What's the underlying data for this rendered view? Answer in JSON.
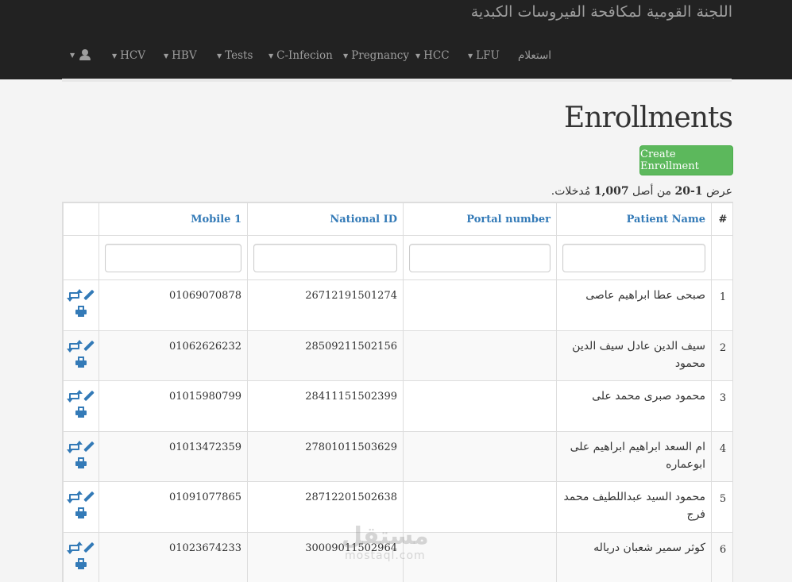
{
  "navbar": {
    "brand": "اللجنة القومية لمكافحة الفيروسات الكبدية",
    "items": [
      {
        "label": "استعلام",
        "caret": false
      },
      {
        "label": "LFU",
        "caret": true
      },
      {
        "label": "HCC",
        "caret": true
      },
      {
        "label": "Pregnancy",
        "caret": true
      },
      {
        "label": "C-Infecion",
        "caret": true
      },
      {
        "label": "Tests",
        "caret": true
      },
      {
        "label": "HBV",
        "caret": true
      },
      {
        "label": "HCV",
        "caret": true
      }
    ],
    "user_icon": "user-icon",
    "background": "#222222",
    "text_color": "#9d9d9d"
  },
  "page": {
    "title": "Enrollments",
    "create_button": "Create Enrollment",
    "create_button_color": "#5cb85c",
    "summary": {
      "prefix": "عرض",
      "range": "1-20",
      "middle": "من أصل",
      "total": "1,007",
      "suffix": "مُدخلات."
    }
  },
  "table": {
    "columns": {
      "num": "#",
      "patient_name": "Patient Name",
      "portal_number": "Portal number",
      "national_id": "National ID",
      "mobile": "Mobile 1"
    },
    "link_color": "#337ab7",
    "rows": [
      {
        "num": "1",
        "name": "صبحى عطا ابراهيم عاصى",
        "portal": "",
        "national_id": "26712191501274",
        "mobile": "01069070878"
      },
      {
        "num": "2",
        "name": "سيف الدين عادل سيف الدين محمود",
        "portal": "",
        "national_id": "28509211502156",
        "mobile": "01062626232"
      },
      {
        "num": "3",
        "name": "محمود صبرى محمد على",
        "portal": "",
        "national_id": "28411151502399",
        "mobile": "01015980799"
      },
      {
        "num": "4",
        "name": "ام السعد ابراهيم ابراهيم على ابوعماره",
        "portal": "",
        "national_id": "27801011503629",
        "mobile": "01013472359"
      },
      {
        "num": "5",
        "name": "محمود السيد عبداللطيف محمد فرج",
        "portal": "",
        "national_id": "28712201502638",
        "mobile": "01091077865"
      },
      {
        "num": "6",
        "name": "كوثر سمير شعبان درياله",
        "portal": "",
        "national_id": "30009011502964",
        "mobile": "01023674233"
      }
    ],
    "action_icons": [
      "retweet-icon",
      "pencil-icon",
      "print-icon"
    ]
  },
  "watermark": {
    "line1": "مستقل",
    "line2": "mostaql.com"
  }
}
